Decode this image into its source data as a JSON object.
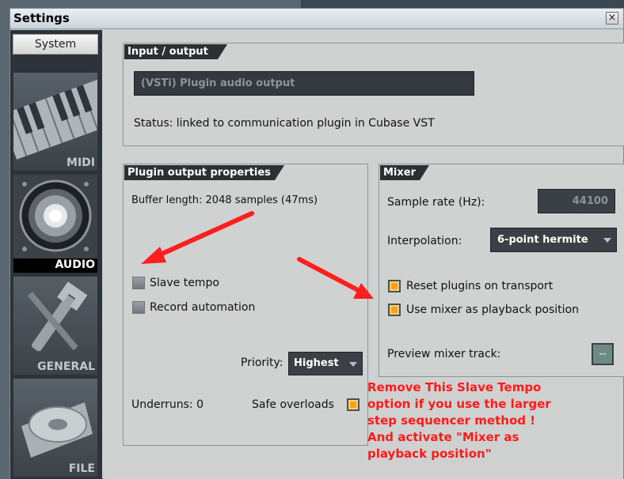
{
  "window": {
    "title": "Settings",
    "close_glyph": "×"
  },
  "sidebar": {
    "system_tab": "System",
    "items": [
      {
        "label": "MIDI",
        "icon": "keyboard-icon",
        "active": false
      },
      {
        "label": "AUDIO",
        "icon": "speaker-icon",
        "active": true
      },
      {
        "label": "GENERAL",
        "icon": "wrench-icon",
        "active": false
      },
      {
        "label": "FILE",
        "icon": "disc-icon",
        "active": false
      }
    ]
  },
  "input_output": {
    "header": "Input / output",
    "device": "(VSTi) Plugin audio output",
    "status": "Status: linked to communication plugin in Cubase VST"
  },
  "plugin_output": {
    "header": "Plugin output properties",
    "buffer": "Buffer length: 2048 samples (47ms)",
    "slave_tempo": {
      "label": "Slave tempo",
      "checked": false
    },
    "record_automation": {
      "label": "Record automation",
      "checked": false
    },
    "priority_label": "Priority:",
    "priority_value": "Highest",
    "underruns": "Underruns: 0",
    "safe_overloads": {
      "label": "Safe overloads",
      "checked": true
    }
  },
  "mixer": {
    "header": "Mixer",
    "sample_rate_label": "Sample rate (Hz):",
    "sample_rate_value": "44100",
    "interpolation_label": "Interpolation:",
    "interpolation_value": "6-point hermite",
    "reset_plugins": {
      "label": "Reset plugins on transport",
      "checked": true
    },
    "mixer_playback": {
      "label": "Use mixer as playback position",
      "checked": true
    },
    "preview_label": "Preview mixer track:",
    "preview_value": "--"
  },
  "annotation": {
    "lines": [
      "Remove This Slave Tempo",
      "option if you use the larger",
      "step sequencer method !",
      "And activate \"Mixer as",
      "playback position\""
    ],
    "color": "#ff1a1a"
  },
  "colors": {
    "accent_checkbox": "#f5a11d",
    "panel_header": "#2b3035",
    "sidebar": "#2c343a"
  }
}
